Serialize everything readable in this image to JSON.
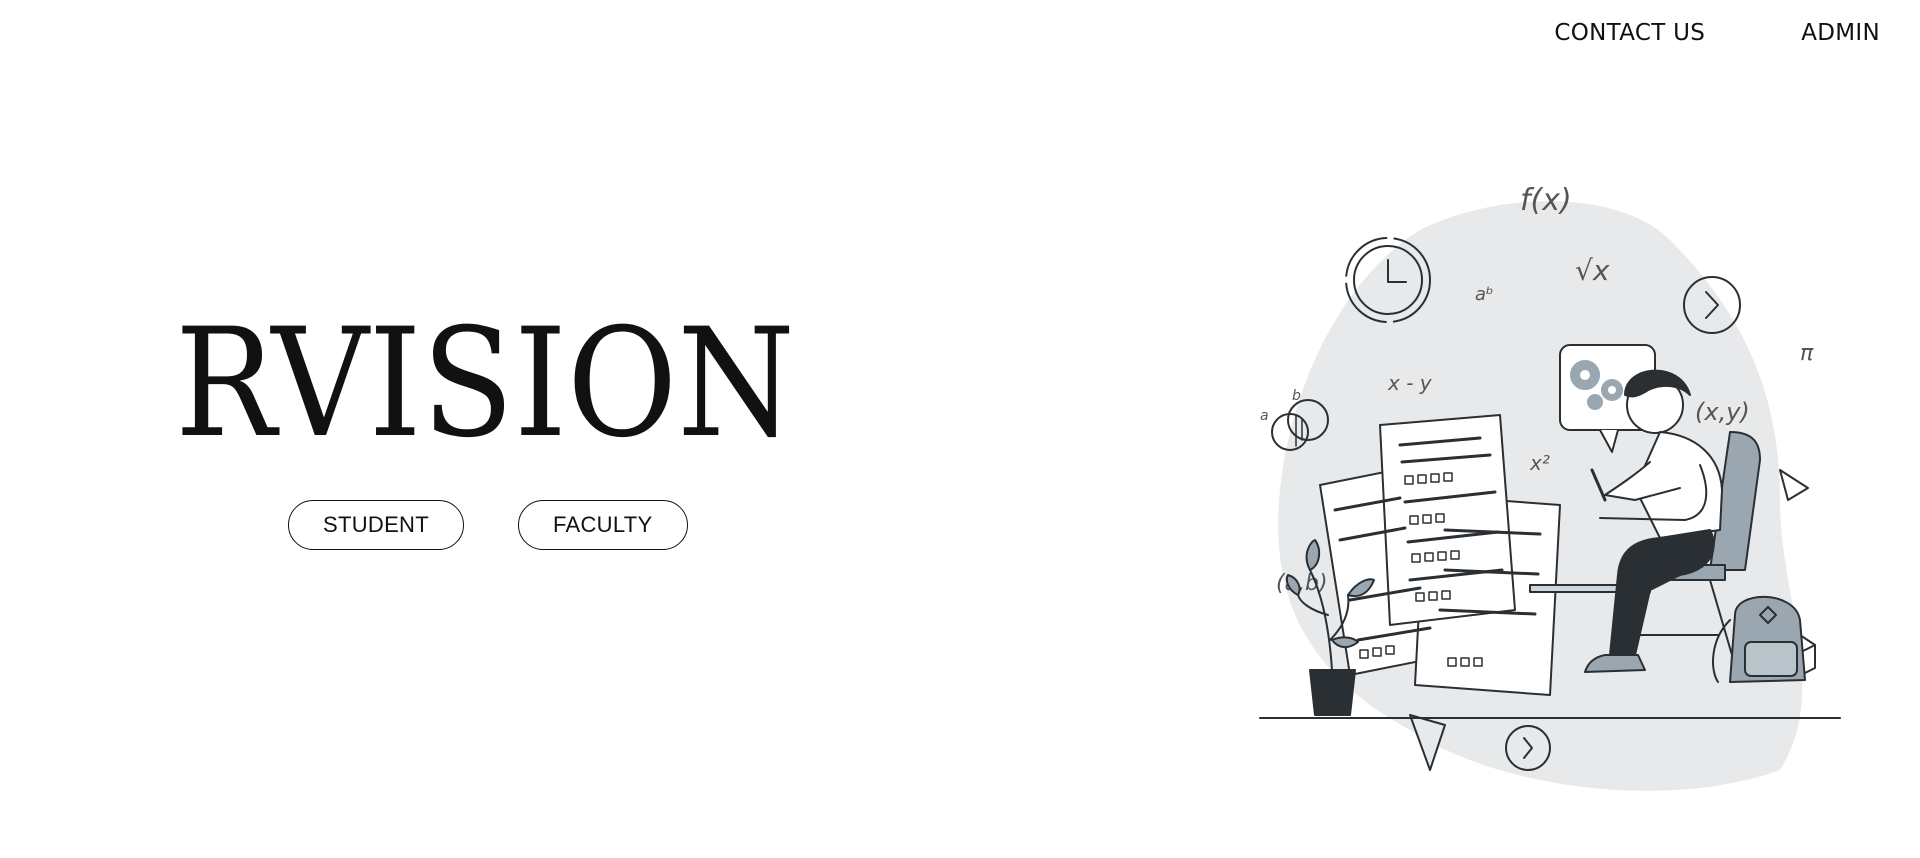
{
  "nav": {
    "contact_label": "CONTACT US",
    "admin_label": "ADMIN"
  },
  "brand": {
    "name": "RVISION"
  },
  "buttons": {
    "student_label": "STUDENT",
    "faculty_label": "FACULTY"
  },
  "illustration": {
    "icon": "student-exam-illustration",
    "symbols": [
      "f(x)",
      "aᵇ",
      "√x",
      "x - y",
      "x²",
      "(x,y)",
      "(a,b)",
      "a",
      "b",
      "π"
    ],
    "colors": {
      "blob": "#e7e9eb",
      "ink": "#2a2f33",
      "accent": "#9aa7b0"
    }
  }
}
